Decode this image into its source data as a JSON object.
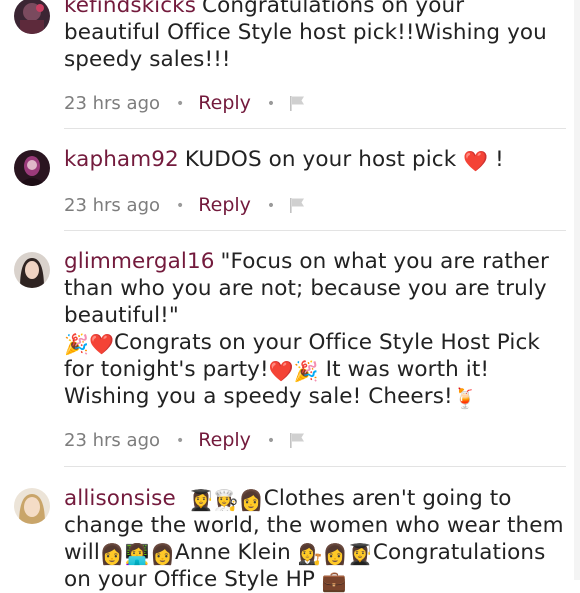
{
  "comments": [
    {
      "username": "kefindskicks",
      "text": "Congratulations on your beautiful Office Style host pick!!Wishing you speedy sales!!!",
      "time": "23 hrs ago",
      "reply_label": "Reply"
    },
    {
      "username": "kapham92",
      "text_before": "KUDOS on your host pick",
      "text_after": "!",
      "time": "23 hrs ago",
      "reply_label": "Reply"
    },
    {
      "username": "glimmergal16",
      "text_quote": "\"Focus on what you are rather than who you are not; because you are truly beautiful!\"",
      "text_part1": "Congrats on your Office Style Host Pick for tonight's party!",
      "text_part2": "It was worth it! Wishing you a speedy sale! Cheers!",
      "time": "23 hrs ago",
      "reply_label": "Reply"
    },
    {
      "username": "allisonsise",
      "text_part1": "Clothes aren't going to change the world, the women who wear them will",
      "text_part2": "Anne Klein",
      "text_part3": "Congratulations on your Office Style HP"
    }
  ],
  "icons": {
    "heart": "❤️",
    "party_popper": "🎉",
    "tropical_drink": "🍹",
    "student": "👩‍🎓",
    "chef": "👩‍🍳",
    "woman": "👩",
    "technologist": "👩‍💻",
    "judge": "👩‍⚖️",
    "briefcase": "💼"
  },
  "colors": {
    "username": "#731a3c",
    "reply": "#731a3c",
    "meta": "#7d7d7d"
  }
}
